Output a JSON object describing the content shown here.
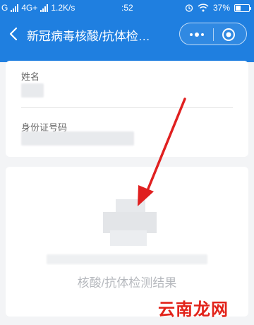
{
  "status_bar": {
    "carrier_left": "G",
    "network": "4G+",
    "speed": "1.2K/s",
    "time": ":52",
    "battery": "37%",
    "battery_level": 0.37
  },
  "header": {
    "title": "新冠病毒核酸/抗体检…",
    "back_icon": "chevron-left-icon",
    "more_icon": "more-dots-icon",
    "close_icon": "target-circle-icon"
  },
  "info_card": {
    "name_label": "姓名",
    "id_label": "身份证号码"
  },
  "result_card": {
    "result_label": "核酸/抗体检测结果"
  },
  "watermark": {
    "text": "云南龙网"
  },
  "colors": {
    "header_bg": "#1f7fe0",
    "arrow": "#e02020",
    "watermark": "#e2231a"
  }
}
